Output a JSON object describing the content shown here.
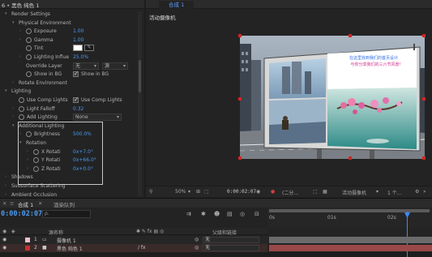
{
  "effect_controls": {
    "header": "6 • 黑色 纯色 1",
    "rows": [
      {
        "label": "Render Settings",
        "indent": 0,
        "twirl": "open"
      },
      {
        "label": "Physical Environment",
        "indent": 1,
        "twirl": "open"
      },
      {
        "label": "Exposure",
        "value": "1.00",
        "indent": 2,
        "twirl": "closed",
        "stopwatch": true
      },
      {
        "label": "Gamma",
        "value": "1.00",
        "indent": 2,
        "twirl": "closed",
        "stopwatch": true
      },
      {
        "label": "Tint",
        "indent": 2,
        "stopwatch": true,
        "swatch": true
      },
      {
        "label": "Lighting Influe",
        "value": "25.0%",
        "indent": 2,
        "twirl": "closed",
        "stopwatch": true
      },
      {
        "label": "Override Layer",
        "dropdown1": "无",
        "dropdown2": "源",
        "indent": 2
      },
      {
        "label": "Show in BG",
        "check_label": "Show in BG",
        "indent": 2,
        "stopwatch": true
      },
      {
        "label": "Rotate Environment",
        "indent": 1,
        "twirl": "closed"
      },
      {
        "label": "Lighting",
        "indent": 0,
        "twirl": "open"
      },
      {
        "label": "Use Comp Lights",
        "check_label": "Use Comp Lights",
        "indent": 1,
        "stopwatch": true
      },
      {
        "label": "Light Falloff",
        "value": "0.32",
        "indent": 1,
        "twirl": "closed",
        "stopwatch": true
      },
      {
        "label": "Add Lighting",
        "dropdown1": "None",
        "indent": 1,
        "twirl": "closed",
        "stopwatch": true
      },
      {
        "label": "Additional Lighting",
        "indent": 1,
        "twirl": "open"
      },
      {
        "label": "Brightness",
        "value": "500.0%",
        "indent": 2,
        "twirl": "closed",
        "stopwatch": true
      },
      {
        "label": "Rotation",
        "indent": 2,
        "twirl": "open"
      },
      {
        "label": "X Rotati",
        "value": "0x+7.0°",
        "indent": 3,
        "twirl": "closed",
        "stopwatch": true
      },
      {
        "label": "Y Rotati",
        "value": "0x+66.0°",
        "indent": 3,
        "twirl": "closed",
        "stopwatch": true
      },
      {
        "label": "Z Rotati",
        "value": "0x+0.0°",
        "indent": 3,
        "twirl": "closed",
        "stopwatch": true
      },
      {
        "label": "Shadows",
        "indent": 0,
        "twirl": "closed"
      },
      {
        "label": "Subsurface Scattering",
        "indent": 0,
        "twirl": "closed"
      },
      {
        "label": "Ambient Occlusion",
        "indent": 0,
        "twirl": "closed"
      }
    ]
  },
  "composition": {
    "tab": "合成 1",
    "sub_label": "活动摄像机",
    "billboard_title": "在这里找到我们的首页设计",
    "billboard_sub": "与你分享我们的三六节风景！",
    "viewer_bar": {
      "zoom": "50%",
      "timecode": "0:00:02:07",
      "resolution": "(二分...",
      "camera": "活动摄像机",
      "views": "1 个..."
    }
  },
  "timeline": {
    "tabs": [
      "合成 1",
      "渲染队列"
    ],
    "timecode": "0:00:02:07",
    "search_placeholder": "ρ.",
    "col_source": "源名称",
    "col_parent": "父级和链接",
    "ruler": [
      "0s",
      "01s",
      "02s"
    ],
    "layers": [
      {
        "index": "1",
        "name": "摄像机 1",
        "color": "#f0c0c8",
        "parent": "无",
        "bar": "#6a6a6a"
      },
      {
        "index": "2",
        "name": "黑色 纯色 1",
        "color": "#c83030",
        "parent": "无",
        "bar": "#9a4848"
      }
    ]
  },
  "colors": {
    "accent": "#4a9af0",
    "highlight_box": "#c9c9c9",
    "handle": "#d02525"
  }
}
